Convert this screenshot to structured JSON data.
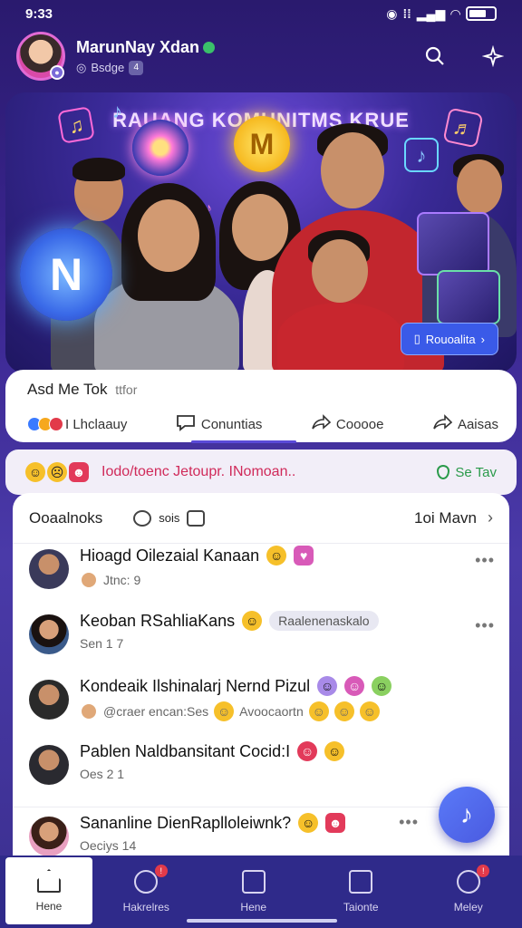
{
  "status_bar": {
    "time": "9:33"
  },
  "header": {
    "name": "MarunNay Xdan",
    "subtitle": "Bsdge",
    "sub_badge": "4"
  },
  "banner": {
    "title": "RAUANG KOMUNITMS KRUE",
    "orb_m": "M",
    "orb_n": "N",
    "cta_label": "Rouoalita"
  },
  "post": {
    "title": "Asd Me Tok",
    "title_meta": "ttfor",
    "actions": {
      "like_label": "I Lhclaauy",
      "comment_label": "Conuntias",
      "share_label": "Cooooe",
      "more_label": "Aaisas"
    }
  },
  "trending": {
    "text": "Iodo/toenc Jetoupr. INomoan..",
    "right_label": "Se Tav"
  },
  "comments": {
    "header_label": "Ooaalnoks",
    "header_small": "sois",
    "sort_label": "1oi Mavn",
    "rows": [
      {
        "name": "Hioagd Oilezaial Kanaan",
        "meta": "Jtnc: 9"
      },
      {
        "name": "Keoban RSahliaKans",
        "chip": "Raalenenaskalo",
        "meta": "Sen 1 7"
      },
      {
        "name": "Kondeaik Ilshinalarj Nernd Pizul",
        "meta_left": "@craer encan:Ses",
        "meta_right": "Avoocaortn"
      },
      {
        "name": "Pablen Naldbansitant Cocid:I",
        "meta": "Oes 2 1"
      },
      {
        "name": "Sananline DienRaplloleiwnk?",
        "meta": "Oeciys 14"
      }
    ]
  },
  "bottom_nav": {
    "items": [
      {
        "label": "Hene"
      },
      {
        "label": "Hakrelres"
      },
      {
        "label": "Hene"
      },
      {
        "label": "Taionte"
      },
      {
        "label": "Meley"
      }
    ]
  }
}
